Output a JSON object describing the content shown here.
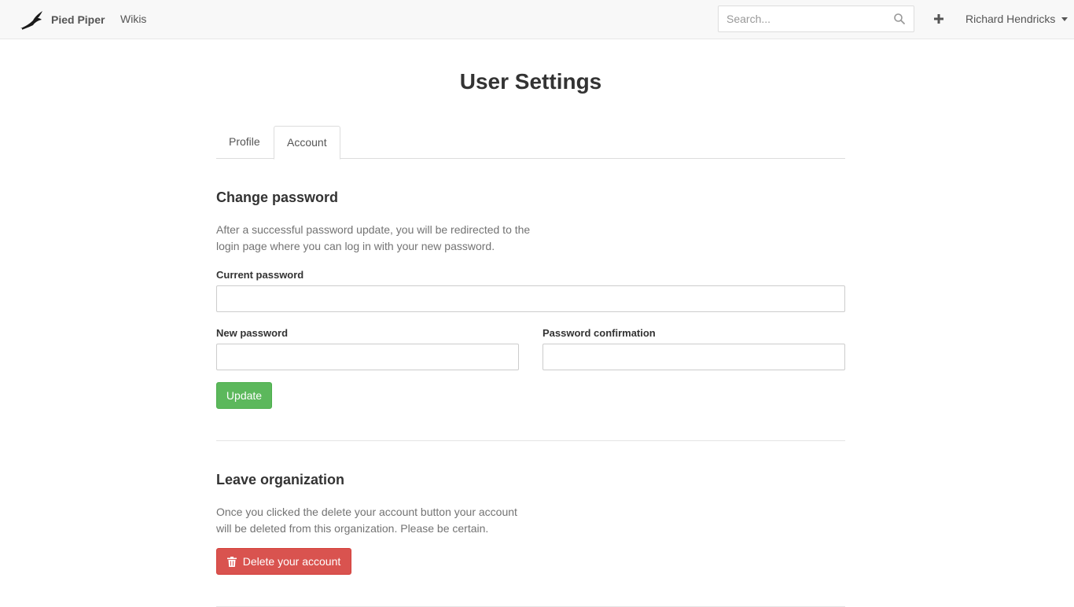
{
  "navbar": {
    "brand": "Pied Piper",
    "nav_wikis": "Wikis",
    "search_placeholder": "Search...",
    "user_name": "Richard Hendricks"
  },
  "page": {
    "title": "User Settings",
    "tabs": [
      {
        "label": "Profile",
        "active": false
      },
      {
        "label": "Account",
        "active": true
      }
    ]
  },
  "change_password": {
    "title": "Change password",
    "help_line1": "After a successful password update, you will be redirected to the",
    "help_line2": "login page where you can log in with your new password.",
    "current_label": "Current password",
    "new_label": "New password",
    "confirm_label": "Password confirmation",
    "update_button": "Update"
  },
  "leave_org": {
    "title": "Leave organization",
    "help_line1": "Once you clicked the delete your account button your account",
    "help_line2": "will be deleted from this organization. Please be certain.",
    "delete_button": "Delete your account"
  },
  "colors": {
    "success": "#5cb85c",
    "danger": "#d9534f",
    "navbar_bg": "#f8f8f8"
  },
  "icons": [
    "bird-logo-icon",
    "search-icon",
    "plus-icon",
    "caret-down-icon",
    "trash-icon"
  ]
}
